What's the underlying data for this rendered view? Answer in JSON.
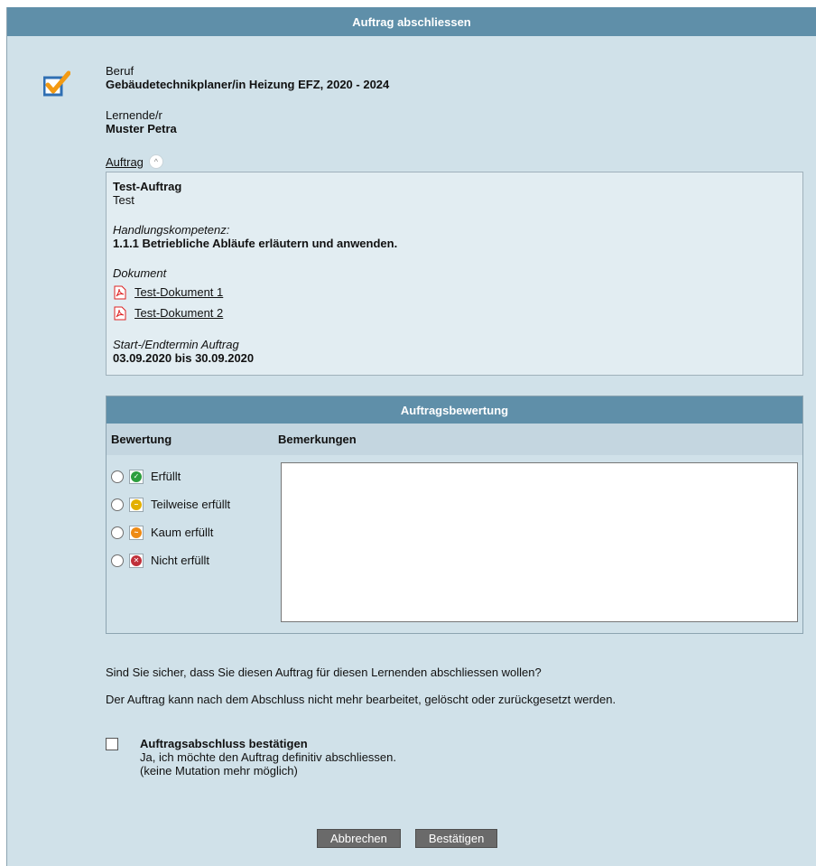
{
  "dialog": {
    "title": "Auftrag abschliessen"
  },
  "beruf": {
    "label": "Beruf",
    "value": "Gebäudetechnikplaner/in Heizung EFZ, 2020 - 2024"
  },
  "lernende": {
    "label": "Lernende/r",
    "value": "Muster Petra"
  },
  "auftrag": {
    "link_label": "Auftrag",
    "name": "Test-Auftrag",
    "description": "Test",
    "kompetenz_label": "Handlungskompetenz:",
    "kompetenz_value": "1.1.1 Betriebliche Abläufe erläutern und anwenden.",
    "dokument_label": "Dokument",
    "documents": [
      "Test-Dokument 1",
      "Test-Dokument 2"
    ],
    "termin_label": "Start-/Endtermin Auftrag",
    "termin_value": "03.09.2020 bis 30.09.2020"
  },
  "bewertung": {
    "title": "Auftragsbewertung",
    "col_bewertung": "Bewertung",
    "col_bemerkungen": "Bemerkungen",
    "options": [
      {
        "label": "Erfüllt",
        "icon": "check-circle-icon",
        "color": "#2e9e3e"
      },
      {
        "label": "Teilweise erfüllt",
        "icon": "minus-circle-icon",
        "color": "#e3b000"
      },
      {
        "label": "Kaum erfüllt",
        "icon": "wave-circle-icon",
        "color": "#ee8a14"
      },
      {
        "label": "Nicht erfüllt",
        "icon": "x-circle-icon",
        "color": "#c0303a"
      }
    ],
    "remarks_value": ""
  },
  "confirm": {
    "question": "Sind Sie sicher, dass Sie diesen Auftrag für diesen Lernenden abschliessen wollen?",
    "warning": "Der Auftrag kann nach dem Abschluss nicht mehr bearbeitet, gelöscht oder zurückgesetzt werden.",
    "checkbox_title": "Auftragsabschluss bestätigen",
    "checkbox_line1": "Ja, ich möchte den Auftrag definitiv abschliessen.",
    "checkbox_line2": "(keine Mutation mehr möglich)"
  },
  "buttons": {
    "cancel": "Abbrechen",
    "confirm": "Bestätigen"
  },
  "colors": {
    "header": "#5f8fa9",
    "background": "#d0e1e9",
    "box": "#e2edf2"
  }
}
